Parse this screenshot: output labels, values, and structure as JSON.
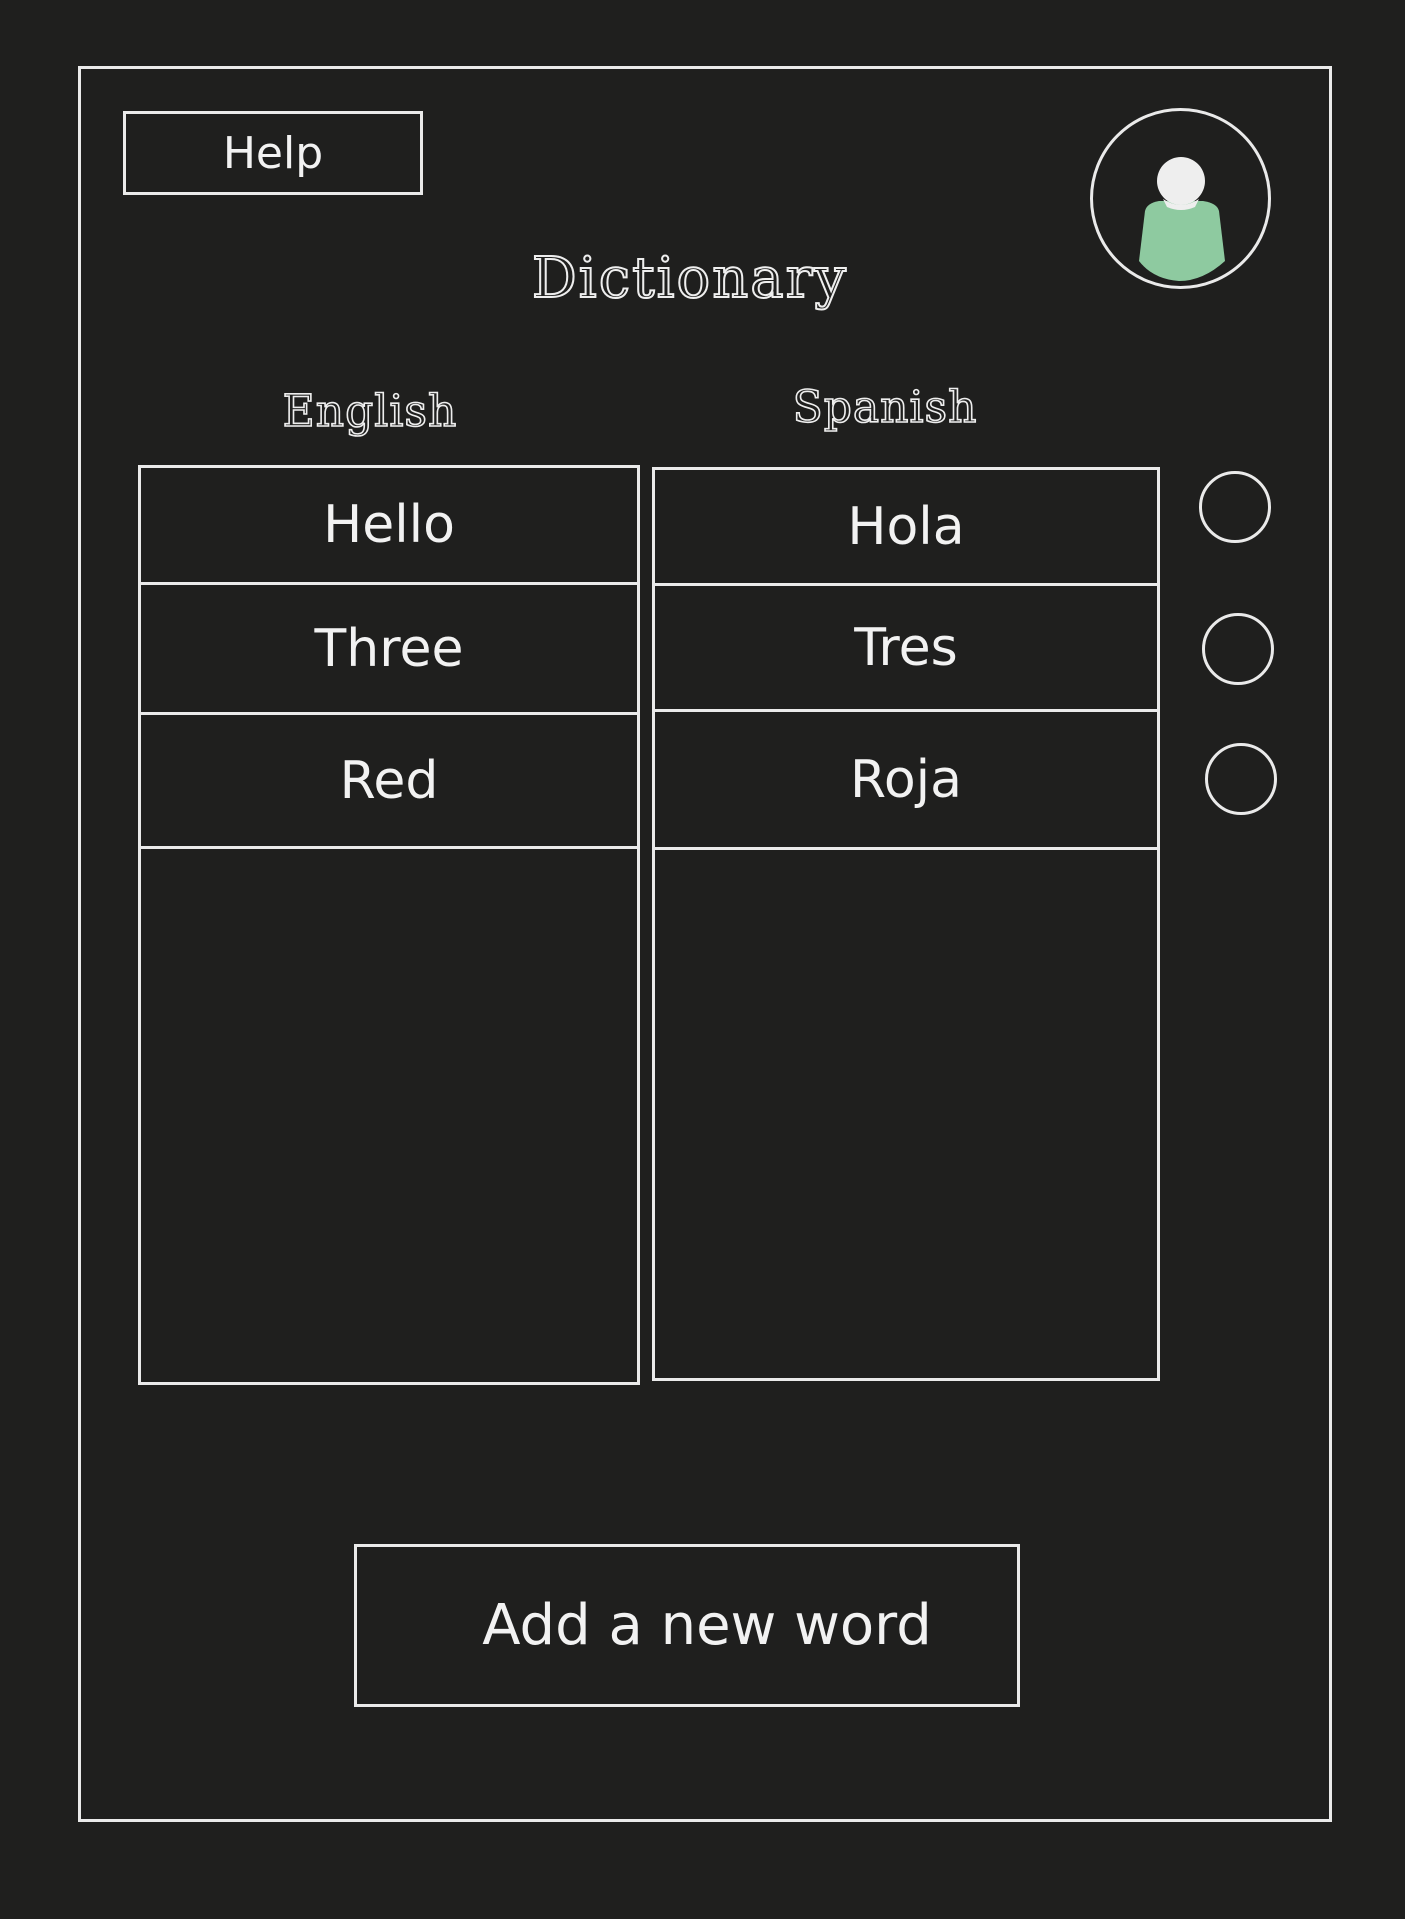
{
  "header": {
    "help_label": "Help",
    "title": "Dictionary"
  },
  "avatar": {
    "icon": "user-avatar-icon",
    "shirt_color": "#8ecaa0",
    "head_color": "#eeeeee"
  },
  "columns": {
    "english_header": "English",
    "spanish_header": "Spanish"
  },
  "words": {
    "english": [
      "Hello",
      "Three",
      "Red"
    ],
    "spanish": [
      "Hola",
      "Tres",
      "Roja"
    ]
  },
  "actions": {
    "add_label": "Add a new word"
  },
  "colors": {
    "background": "#1f1f1e",
    "stroke": "#eaeaea"
  }
}
